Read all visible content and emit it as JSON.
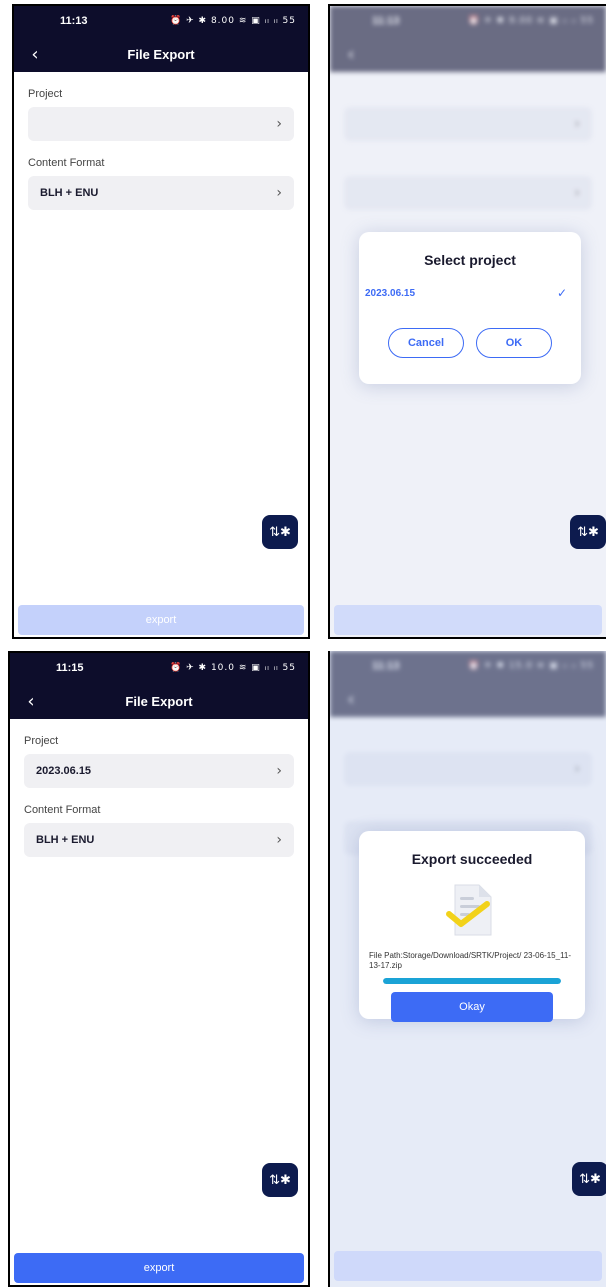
{
  "screens": [
    {
      "status": {
        "time": "11:13",
        "icons": "⏰ ✈ ✱ 8.00 ≋ ▣ ᵢₗ ᵢₗ 55"
      },
      "nav": {
        "back_icon": "chevron-left-icon",
        "title": "File Export"
      },
      "project": {
        "label": "Project",
        "value": ""
      },
      "format": {
        "label": "Content Format",
        "value": "BLH + ENU"
      },
      "export_label": "export"
    },
    {
      "status": {
        "time": "11:13",
        "icons": "⏰ ✈ ✱ 9.00 ≋ ▣ ᵢₗ ᵢₗ 55"
      },
      "dialog": {
        "title": "Select project",
        "item": "2023.06.15",
        "cancel": "Cancel",
        "ok": "OK"
      }
    },
    {
      "status": {
        "time": "11:15",
        "icons": "⏰ ✈ ✱ 10.0 ≋ ▣ ᵢₗ ᵢₗ 55"
      },
      "nav": {
        "title": "File Export"
      },
      "project": {
        "label": "Project",
        "value": "2023.06.15"
      },
      "format": {
        "label": "Content Format",
        "value": "BLH + ENU"
      },
      "export_label": "export"
    },
    {
      "status": {
        "time": "11:13",
        "icons": "⏰ ✈ ✱ 15.0 ≋ ▣ ᵢₗ ᵢₗ 55"
      },
      "dialog": {
        "title": "Export succeeded",
        "path": "File Path:Storage/Download/SRTK/Project/ 23-06-15_11-13-17.zip",
        "progress": 1.0,
        "okay": "Okay"
      }
    }
  ],
  "colors": {
    "nav_bg": "#0d0d2b",
    "accent": "#3d6bf5",
    "export_disabled": "#c4d1fb",
    "progress": "#1aa3d6"
  }
}
